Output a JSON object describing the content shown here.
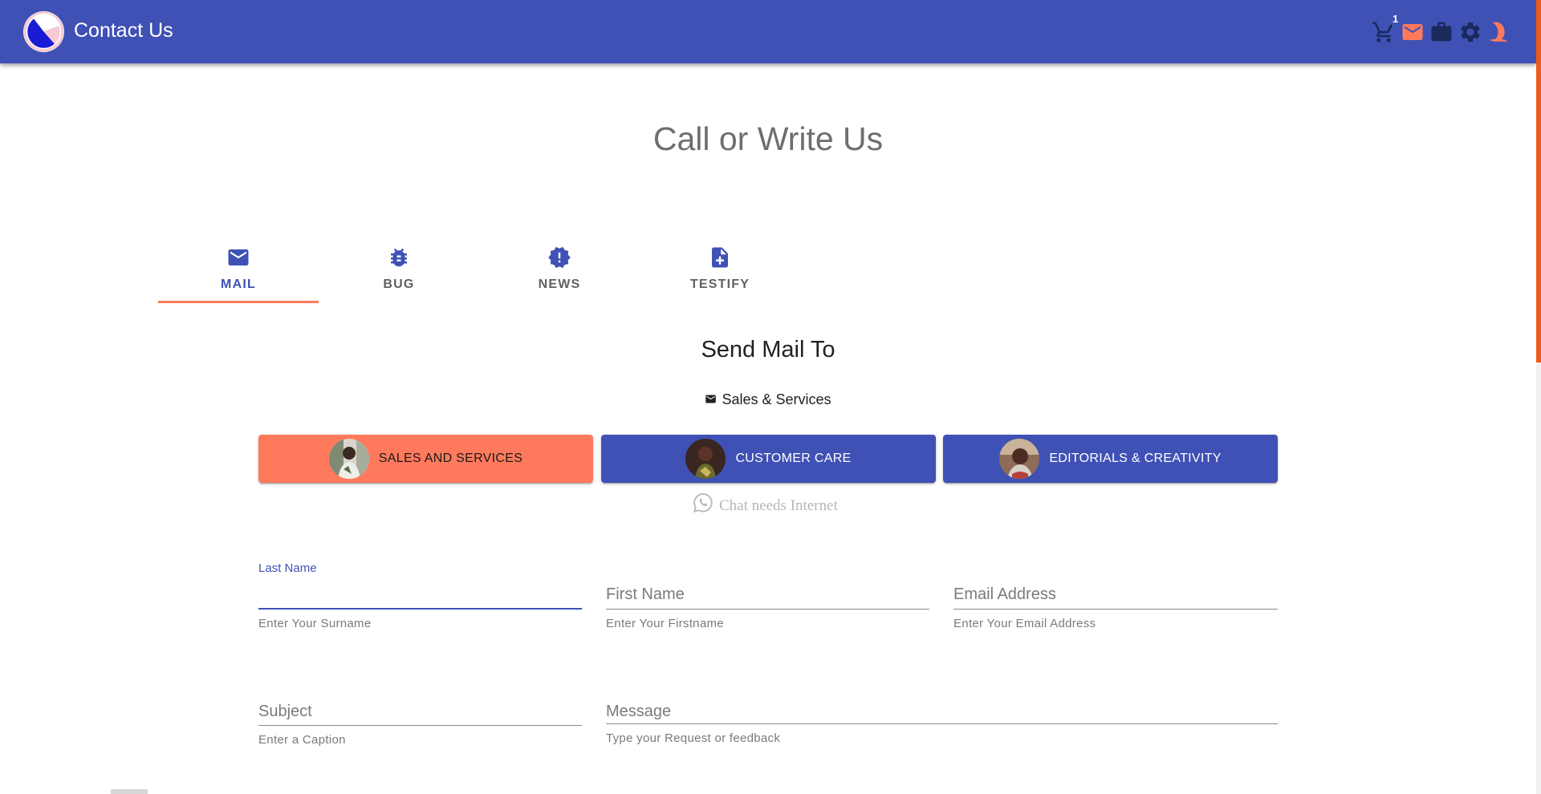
{
  "app_bar": {
    "title": "Contact Us",
    "cart_count": "1",
    "icons": [
      "logo-icon",
      "cart-icon",
      "mail-icon",
      "briefcase-icon",
      "settings-icon",
      "night-mode-icon"
    ],
    "colors": {
      "primary": "#3f51b5",
      "accent": "#ff7a5c",
      "icon_dark": "#1a2a5a"
    }
  },
  "heading": "Call or Write Us",
  "tabs": [
    {
      "label": "MAIL",
      "icon": "mail-icon",
      "active": true
    },
    {
      "label": "BUG",
      "icon": "bug-icon",
      "active": false
    },
    {
      "label": "NEWS",
      "icon": "new-releases-icon",
      "active": false
    },
    {
      "label": "TESTIFY",
      "icon": "note-add-icon",
      "active": false
    }
  ],
  "send_mail": {
    "title": "Send Mail To",
    "recipient": "Sales & Services"
  },
  "departments": [
    {
      "label": "SALES AND SERVICES",
      "selected": true
    },
    {
      "label": "CUSTOMER CARE",
      "selected": false
    },
    {
      "label": "EDITORIALS & CREATIVITY",
      "selected": false
    }
  ],
  "chat_note": "Chat needs Internet",
  "form": {
    "last_name": {
      "label": "Last Name",
      "value": "",
      "helper": "Enter Your Surname"
    },
    "first_name": {
      "placeholder": "First Name",
      "value": "",
      "helper": "Enter Your Firstname"
    },
    "email": {
      "placeholder": "Email Address",
      "value": "",
      "helper": "Enter Your Email Address"
    },
    "subject": {
      "placeholder": "Subject",
      "value": "",
      "helper": "Enter a Caption"
    },
    "message": {
      "placeholder": "Message",
      "value": "",
      "helper": "Type your Request or feedback"
    }
  }
}
